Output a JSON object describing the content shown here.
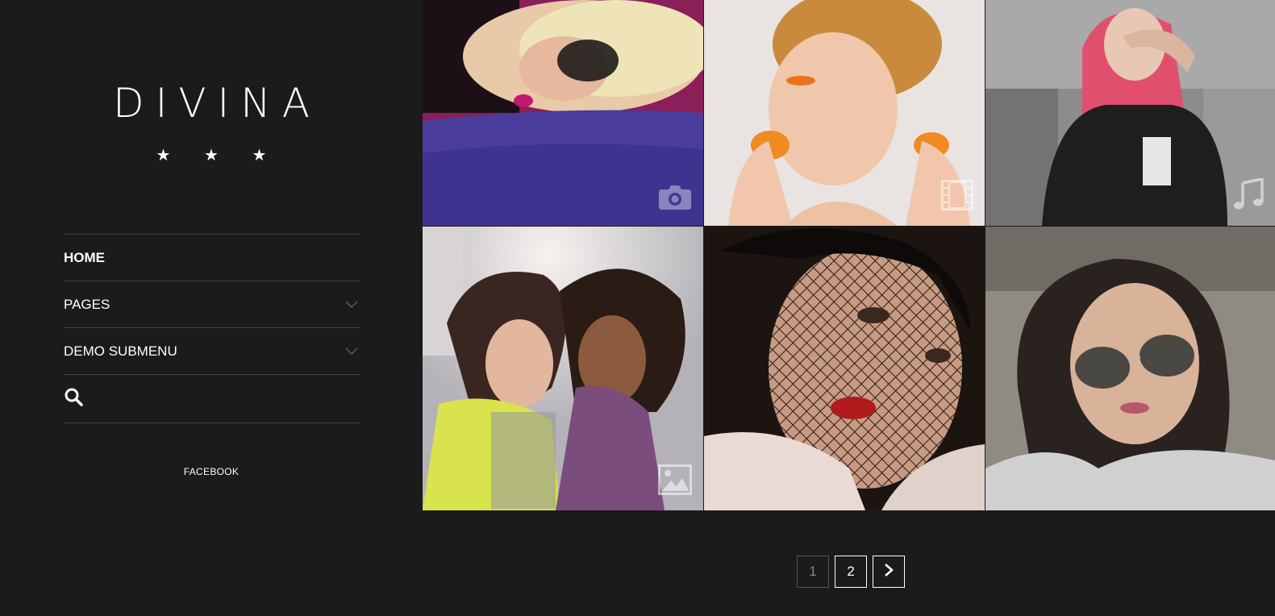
{
  "brand": {
    "logo": "DIVINA",
    "stars": "★ ★ ★"
  },
  "nav": {
    "items": [
      {
        "label": "HOME",
        "active": true
      },
      {
        "label": "PAGES",
        "has_submenu": true
      },
      {
        "label": "DEMO SUBMENU",
        "has_submenu": true
      }
    ],
    "search_icon": "search-icon"
  },
  "social": {
    "facebook": "FACEBOOK"
  },
  "gallery": {
    "tiles": [
      {
        "subject": "blonde woman with black lace mask on purple blanket",
        "type_icon": "camera-icon"
      },
      {
        "subject": "girl with orange makeup eating tangerine",
        "type_icon": "film-icon"
      },
      {
        "subject": "woman with pink hair in black shirt",
        "type_icon": "music-icon"
      },
      {
        "subject": "two women laughing outdoors",
        "type_icon": "image-icon"
      },
      {
        "subject": "woman with black net veil and red lips",
        "type_icon": ""
      },
      {
        "subject": "woman with aviator sunglasses",
        "type_icon": ""
      }
    ]
  },
  "pagination": {
    "pages": [
      "1",
      "2"
    ],
    "current": "1",
    "next_icon": "chevron-right-icon"
  },
  "colors": {
    "background": "#1b1b1b",
    "divider": "#424242",
    "text": "#ffffff"
  }
}
